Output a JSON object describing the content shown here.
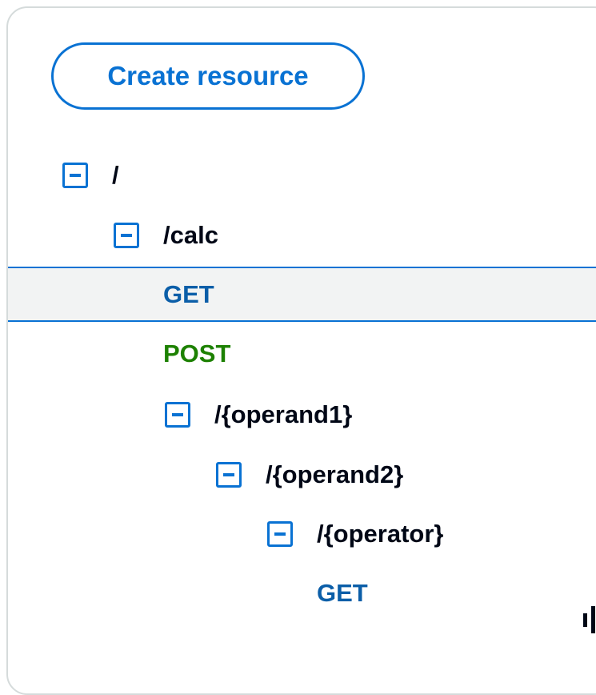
{
  "actions": {
    "create_resource_label": "Create resource"
  },
  "tree": {
    "root": {
      "path": "/"
    },
    "calc": {
      "path": "/calc"
    },
    "calc_get": {
      "method": "GET"
    },
    "calc_post": {
      "method": "POST"
    },
    "operand1": {
      "path": "/{operand1}"
    },
    "operand2": {
      "path": "/{operand2}"
    },
    "operator": {
      "path": "/{operator}"
    },
    "operator_get": {
      "method": "GET"
    }
  },
  "selected_item": "calc_get",
  "colors": {
    "accent": "#0972d3",
    "get_method": "#0b5ea8",
    "post_method": "#1d8102",
    "selected_background": "#f2f3f3",
    "text": "#000716",
    "panel_border": "#d5dbdb"
  },
  "icons": {
    "expanded_toggle": "collapse-square-minus-icon",
    "resize": "resize-handle-icon"
  }
}
